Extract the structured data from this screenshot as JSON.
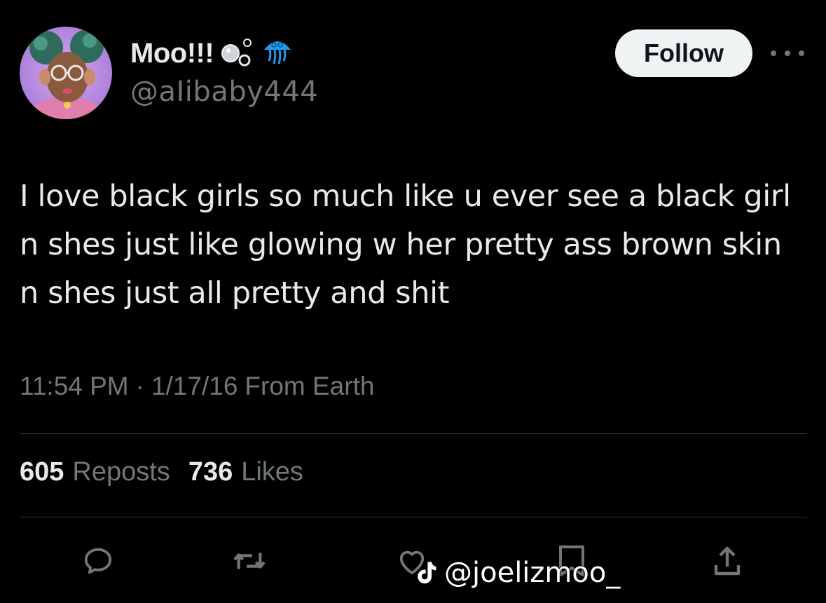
{
  "user": {
    "display_name": "Moo!!!",
    "handle": "@aIibaby444",
    "badges": [
      "bubbles-icon",
      "jellyfish-icon"
    ]
  },
  "follow_label": "Follow",
  "tweet": {
    "text": "I love black girls so much like u ever see a black girl n shes just like glowing w her pretty ass brown skin n shes just all pretty and shit"
  },
  "meta": {
    "time": "11:54 PM",
    "separator": "·",
    "date": "1/17/16",
    "source": "From Earth"
  },
  "stats": {
    "reposts_count": "605",
    "reposts_label": "Reposts",
    "likes_count": "736",
    "likes_label": "Likes"
  },
  "actions": [
    "reply-icon",
    "repost-icon",
    "like-icon",
    "bookmark-icon",
    "share-icon"
  ],
  "watermark": {
    "handle": "@joelizmoo_",
    "logo": "tiktok-logo-icon"
  },
  "colors": {
    "background": "#000000",
    "text_primary": "#e7e9ea",
    "text_secondary": "#71767b",
    "divider": "#2f3336",
    "follow_bg": "#eff3f4",
    "badge_blue": "#1d9bf0"
  }
}
